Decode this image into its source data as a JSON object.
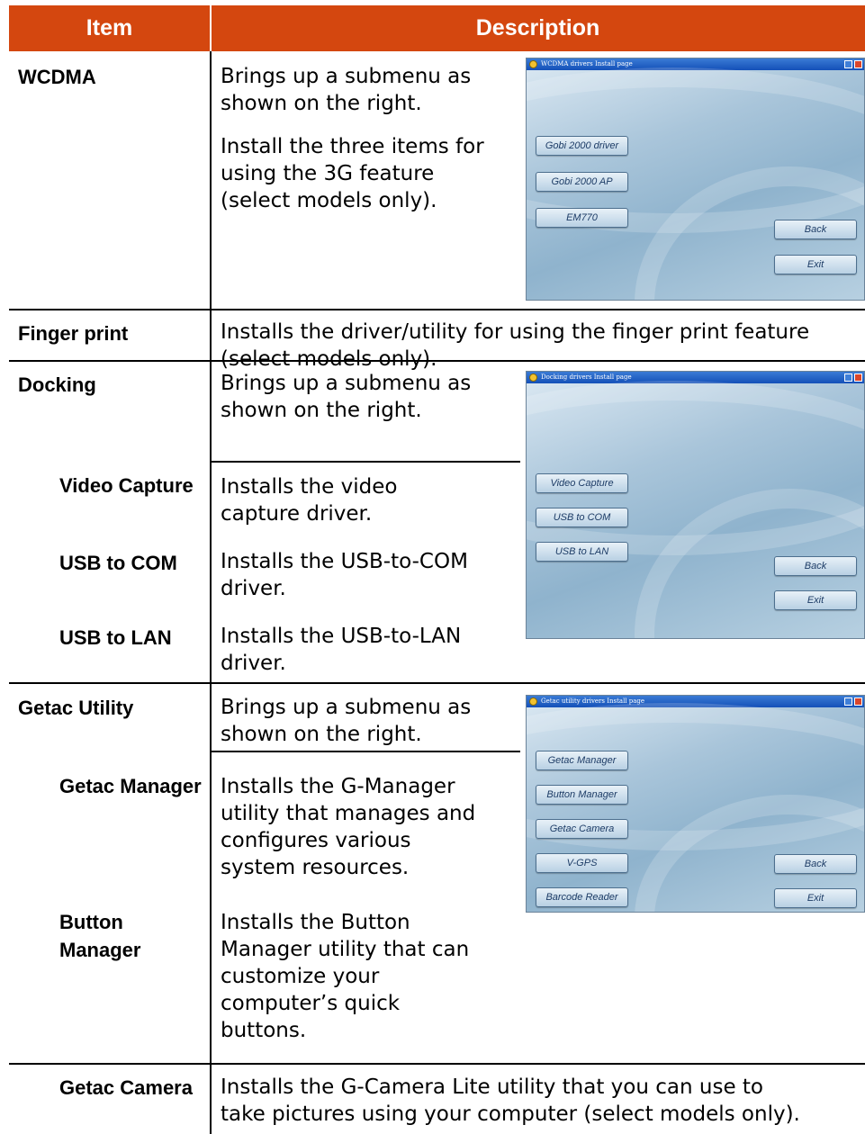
{
  "header": {
    "item": "Item",
    "description": "Description"
  },
  "rows": [
    {
      "item": "WCDMA",
      "desc": [
        "Brings up a submenu as",
        "shown on the right."
      ],
      "desc2": [
        "Install the three items for",
        "using the 3G feature",
        "(select models only)."
      ]
    },
    {
      "item": "Finger print",
      "desc": [
        "Installs the driver/utility for using the finger print feature",
        "(select models only)."
      ]
    },
    {
      "item": "Docking",
      "desc": [
        "Brings up a submenu as",
        "shown on the right."
      ]
    },
    {
      "item": "Video Capture",
      "desc": [
        "Installs the video",
        "capture driver."
      ]
    },
    {
      "item": "USB to COM",
      "desc": [
        "Installs the USB-to-COM",
        "driver."
      ]
    },
    {
      "item": "USB to LAN",
      "desc": [
        "Installs the USB-to-LAN",
        "driver."
      ]
    },
    {
      "item": "Getac Utility",
      "desc": [
        "Brings up a submenu as",
        "shown on the right."
      ]
    },
    {
      "item": "Getac Manager",
      "desc": [
        "Installs the G-Manager",
        "utility that manages and",
        "configures various",
        "system resources."
      ]
    },
    {
      "item": [
        "Button",
        "Manager"
      ],
      "desc": [
        "Installs the Button",
        "Manager utility that can",
        "customize your",
        "computer’s quick",
        "buttons."
      ]
    },
    {
      "item": "Getac Camera",
      "desc": [
        "Installs the G-Camera Lite utility that you can use to",
        "take pictures using your computer (select models only)."
      ]
    }
  ],
  "screens": {
    "wcdma": {
      "title": "WCDMA drivers Install page",
      "buttons": [
        "Gobi 2000 driver",
        "Gobi 2000 AP",
        "EM770"
      ],
      "back": "Back",
      "exit": "Exit"
    },
    "docking": {
      "title": "Docking drivers Install page",
      "buttons": [
        "Video Capture",
        "USB to COM",
        "USB to LAN"
      ],
      "back": "Back",
      "exit": "Exit"
    },
    "getac": {
      "title": "Getac utility drivers Install page",
      "buttons": [
        "Getac Manager",
        "Button Manager",
        "Getac Camera",
        "V-GPS",
        "Barcode Reader"
      ],
      "back": "Back",
      "exit": "Exit"
    }
  }
}
